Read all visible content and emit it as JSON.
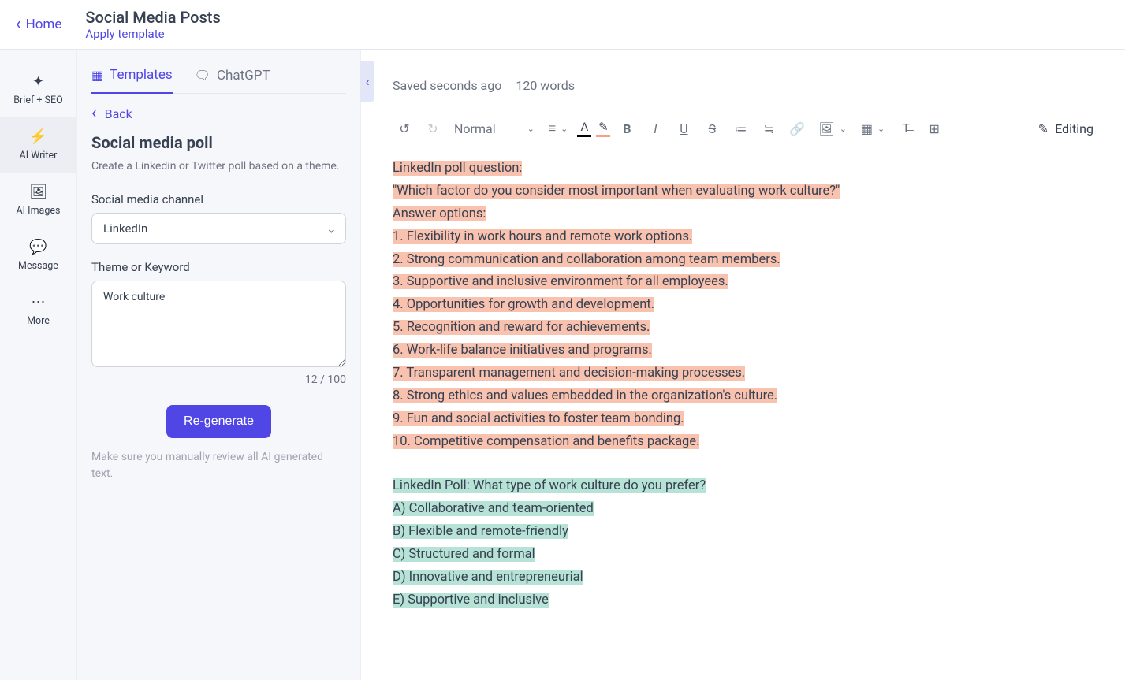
{
  "header": {
    "home": "Home",
    "title": "Social Media Posts",
    "apply_template": "Apply template"
  },
  "rail": {
    "brief": "Brief + SEO",
    "writer": "AI Writer",
    "images": "AI Images",
    "message": "Message",
    "more": "More"
  },
  "panel": {
    "tab_templates": "Templates",
    "tab_chatgpt": "ChatGPT",
    "back": "Back",
    "heading": "Social media poll",
    "description": "Create a Linkedin or Twitter poll based on a theme.",
    "channel_label": "Social media channel",
    "channel_value": "LinkedIn",
    "theme_label": "Theme or Keyword",
    "theme_value": "Work culture",
    "counter": "12 / 100",
    "regenerate": "Re-generate",
    "disclaimer": "Make sure you manually review all AI generated text."
  },
  "editor": {
    "saved": "Saved seconds ago",
    "words": "120 words",
    "format": "Normal",
    "editing": "Editing"
  },
  "doc": {
    "o1": "LinkedIn poll question:",
    "o2": "\"Which factor do you consider most important when evaluating work culture?\"",
    "o3": "Answer options:",
    "o4": "1. Flexibility in work hours and remote work options.",
    "o5": "2. Strong communication and collaboration among team members.",
    "o6": "3. Supportive and inclusive environment for all employees.",
    "o7": "4. Opportunities for growth and development.",
    "o8": "5. Recognition and reward for achievements.",
    "o9": "6. Work-life balance initiatives and programs.",
    "o10": "7. Transparent management and decision-making processes.",
    "o11": "8. Strong ethics and values embedded in the organization's culture.",
    "o12": "9. Fun and social activities to foster team bonding.",
    "o13": "10. Competitive compensation and benefits package.",
    "t1": "LinkedIn Poll: What type of work culture do you prefer?",
    "t2": "A) Collaborative and team-oriented",
    "t3": "B) Flexible and remote-friendly",
    "t4": "C) Structured and formal",
    "t5": "D) Innovative and entrepreneurial",
    "t6": "E) Supportive and inclusive"
  }
}
